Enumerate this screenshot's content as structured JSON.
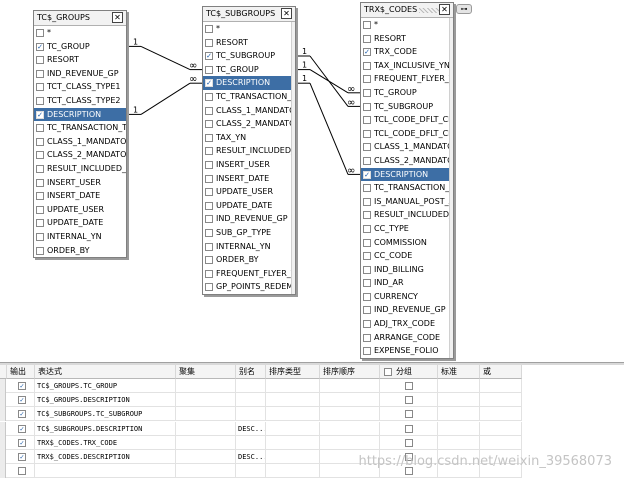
{
  "tables": [
    {
      "id": "tc-groups",
      "title": "TC$_GROUPS",
      "columns": [
        "*",
        "TC_GROUP",
        "RESORT",
        "IND_REVENUE_GP",
        "TCT_CLASS_TYPE1",
        "TCT_CLASS_TYPE2",
        "DESCRIPTION",
        "TC_TRANSACTION_T",
        "CLASS_1_MANDATOR",
        "CLASS_2_MANDATOR",
        "RESULT_INCLUDED_",
        "INSERT_USER",
        "INSERT_DATE",
        "UPDATE_USER",
        "UPDATE_DATE",
        "INTERNAL_YN",
        "ORDER_BY"
      ],
      "checked": [
        false,
        true,
        false,
        false,
        false,
        false,
        true,
        false,
        false,
        false,
        false,
        false,
        false,
        false,
        false,
        false,
        false
      ],
      "selected_index": 6
    },
    {
      "id": "tc-subgroups",
      "title": "TC$_SUBGROUPS",
      "columns": [
        "*",
        "RESORT",
        "TC_SUBGROUP",
        "TC_GROUP",
        "DESCRIPTION",
        "TC_TRANSACTION_T",
        "CLASS_1_MANDATOR",
        "CLASS_2_MANDATOR",
        "TAX_YN",
        "RESULT_INCLUDED_",
        "INSERT_USER",
        "INSERT_DATE",
        "UPDATE_USER",
        "UPDATE_DATE",
        "IND_REVENUE_GP",
        "SUB_GP_TYPE",
        "INTERNAL_YN",
        "ORDER_BY",
        "FREQUENT_FLYER_Y",
        "GP_POINTS_REDEMP"
      ],
      "checked": [
        false,
        false,
        true,
        false,
        true,
        false,
        false,
        false,
        false,
        false,
        false,
        false,
        false,
        false,
        false,
        false,
        false,
        false,
        false,
        false
      ],
      "selected_index": 4
    },
    {
      "id": "trx-codes",
      "title": "TRX$_CODES",
      "columns": [
        "*",
        "RESORT",
        "TRX_CODE",
        "TAX_INCLUSIVE_YN",
        "FREQUENT_FLYER_Y",
        "TC_GROUP",
        "TC_SUBGROUP",
        "TCL_CODE_DFLT_CL",
        "TCL_CODE_DFLT_CL",
        "CLASS_1_MANDATOR",
        "CLASS_2_MANDATOR",
        "DESCRIPTION",
        "TC_TRANSACTION_T",
        "IS_MANUAL_POST_AI",
        "RESULT_INCLUDED_",
        "CC_TYPE",
        "COMMISSION",
        "CC_CODE",
        "IND_BILLING",
        "IND_AR",
        "CURRENCY",
        "IND_REVENUE_GP",
        "ADJ_TRX_CODE",
        "ARRANGE_CODE",
        "EXPENSE_FOLIO"
      ],
      "checked": [
        false,
        false,
        true,
        false,
        false,
        false,
        false,
        false,
        false,
        false,
        false,
        true,
        false,
        false,
        false,
        false,
        false,
        false,
        false,
        false,
        false,
        false,
        false,
        false,
        false
      ],
      "selected_index": 11
    }
  ],
  "relationship_labels": {
    "one": "1",
    "many": "∞"
  },
  "pin_icon": "pin-icon",
  "grid": {
    "headers": {
      "output": "输出",
      "expression": "表达式",
      "aggregate": "聚集",
      "alias": "别名",
      "sort_type": "排序类型",
      "sort_order": "排序顺序",
      "group": "分组",
      "criteria": "标准",
      "or": "或"
    },
    "rows": [
      {
        "output": true,
        "expression": "TC$_GROUPS.TC_GROUP",
        "alias": ""
      },
      {
        "output": true,
        "expression": "TC$_GROUPS.DESCRIPTION",
        "alias": ""
      },
      {
        "output": true,
        "expression": "TC$_SUBGROUPS.TC_SUBGROUP",
        "alias": ""
      },
      {
        "output": true,
        "expression": "TC$_SUBGROUPS.DESCRIPTION",
        "alias": "DESC..."
      },
      {
        "output": true,
        "expression": "TRX$_CODES.TRX_CODE",
        "alias": ""
      },
      {
        "output": true,
        "expression": "TRX$_CODES.DESCRIPTION",
        "alias": "DESC..."
      },
      {
        "output": false,
        "expression": "",
        "alias": ""
      }
    ]
  },
  "watermark": "https://blog.csdn.net/weixin_39568073",
  "colors": {
    "selection": "#3d6ea5",
    "check": "#1a5aa8"
  }
}
